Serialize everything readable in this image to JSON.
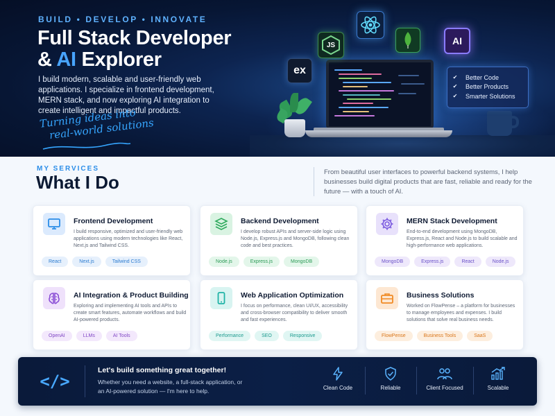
{
  "hero": {
    "tagline": "BUILD  •  DEVELOP  •  INNOVATE",
    "title_line1": "Full Stack Developer",
    "title_line2_prefix": "& ",
    "title_line2_accent": "AI",
    "title_line2_suffix": " Explorer",
    "description": "I build modern, scalable and user-friendly web applications. I specialize in frontend development, MERN stack, and now exploring AI integration to create intelligent and impactful products.",
    "handwritten_line1": "Turning ideas into",
    "handwritten_line2": "real-world solutions",
    "tech_icons": [
      {
        "name": "express",
        "label": "ex"
      },
      {
        "name": "nodejs",
        "label": "JS"
      },
      {
        "name": "react",
        "label": ""
      },
      {
        "name": "mongodb",
        "label": ""
      },
      {
        "name": "ai-chip",
        "label": "AI"
      }
    ],
    "checklist": [
      "Better Code",
      "Better Products",
      "Smarter Solutions"
    ],
    "colors": {
      "accent": "#48a4ff",
      "bg_dark": "#071634"
    }
  },
  "services": {
    "eyebrow": "MY SERVICES",
    "title": "What I Do",
    "intro": "From beautiful user interfaces to powerful backend systems, I help businesses build digital products that are fast, reliable and ready for the future — with a touch of AI.",
    "cards": [
      {
        "title": "Frontend Development",
        "description": "I build responsive, optimized and user-friendly web applications using modern technologies like React, Next.js and Tailwind CSS.",
        "icon": "monitor-icon",
        "tags": [
          "React",
          "Next.js",
          "Tailwind CSS"
        ],
        "color": "#2b8de8"
      },
      {
        "title": "Backend Development",
        "description": "I develop robust APIs and server-side logic using Node.js, Express.js and MongoDB, following clean code and best practices.",
        "icon": "layers-icon",
        "tags": [
          "Node.js",
          "Express.js",
          "MongoDB"
        ],
        "color": "#2eaa5c"
      },
      {
        "title": "MERN Stack Development",
        "description": "End-to-end development using MongoDB, Express.js, React and Node.js to build scalable and high-performance web applications.",
        "icon": "gear-icon",
        "tags": [
          "MongoDB",
          "Express.js",
          "React",
          "Node.js"
        ],
        "color": "#7c5ce0"
      },
      {
        "title": "AI Integration & Product Building",
        "description": "Exploring and implementing AI tools and APIs to create smart features, automate workflows and build AI-powered products.",
        "icon": "brain-icon",
        "tags": [
          "OpenAI",
          "LLMs",
          "AI Tools"
        ],
        "color": "#8b4fd6"
      },
      {
        "title": "Web Application Optimization",
        "description": "I focus on performance, clean UI/UX, accessibility and cross-browser compatibility to deliver smooth and fast experiences.",
        "icon": "mobile-icon",
        "tags": [
          "Performance",
          "SEO",
          "Responsive"
        ],
        "color": "#1fb3a6"
      },
      {
        "title": "Business Solutions",
        "description": "Worked on FlowPense – a platform for businesses to manage employees and expenses. I build solutions that solve real business needs.",
        "icon": "briefcase-icon",
        "tags": [
          "FlowPense",
          "Business Tools",
          "SaaS"
        ],
        "color": "#f08a24"
      }
    ]
  },
  "cta": {
    "icon": "</>",
    "title": "Let's build something great together!",
    "text": "Whether you need a website, a full-stack application, or an AI-powered solution — I'm here to help.",
    "features": [
      {
        "label": "Clean Code",
        "icon": "lightning-icon"
      },
      {
        "label": "Reliable",
        "icon": "shield-check-icon"
      },
      {
        "label": "Client Focused",
        "icon": "users-icon"
      },
      {
        "label": "Scalable",
        "icon": "growth-chart-icon"
      }
    ]
  }
}
